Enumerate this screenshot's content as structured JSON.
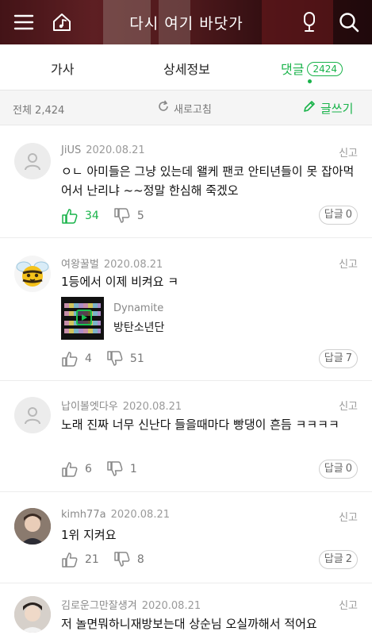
{
  "header": {
    "title": "다시 여기 바닷가",
    "icons": [
      "menu-icon",
      "home-music-icon",
      "mic-icon",
      "search-icon"
    ]
  },
  "tabs": [
    {
      "label": "가사"
    },
    {
      "label": "상세정보"
    },
    {
      "label": "댓글",
      "badge": "2424",
      "active": true
    }
  ],
  "toolbar": {
    "total": "전체 2,424",
    "refresh": "새로고침",
    "write": "글쓰기"
  },
  "report_label": "신고",
  "reply_label": "답글",
  "colors": {
    "accent": "#19b34a"
  },
  "comments": [
    {
      "user": "JiUS",
      "date": "2020.08.21",
      "text": "ㅇㄴ 아미들은 그냥 있는데 왤케 팬코 안티년들이 못 잡아먹어서 난리냐 ~~정말 한심해 죽겠오",
      "likes": "34",
      "dislikes": "5",
      "replies": "0",
      "liked": true
    },
    {
      "user": "여왕꿀벌",
      "date": "2020.08.21",
      "text": "1등에서 이제 비켜요 ㅋ",
      "song": {
        "title": "Dynamite",
        "artist": "방탄소년단"
      },
      "likes": "4",
      "dislikes": "51",
      "replies": "7"
    },
    {
      "user": "납이볼엣다우",
      "date": "2020.08.21",
      "text": "노래 진짜 너무 신난다 들을때마다 빵댕이 흔듬 ㅋㅋㅋㅋ",
      "likes": "6",
      "dislikes": "1",
      "replies": "0"
    },
    {
      "user": "kimh77a",
      "date": "2020.08.21",
      "text": "1위 지켜요",
      "likes": "21",
      "dislikes": "8",
      "replies": "2"
    },
    {
      "user": "김로운그만잘생겨",
      "date": "2020.08.21",
      "text": "저 놀면뭐하니재방보는대 상순님 오실까해서 적어요"
    }
  ]
}
